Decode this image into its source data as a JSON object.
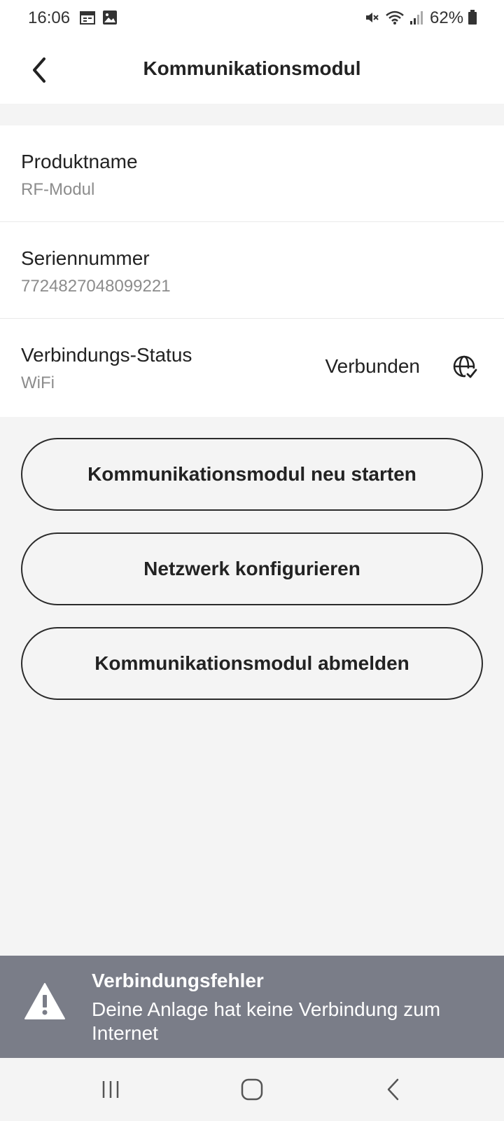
{
  "status_bar": {
    "time": "16:06",
    "battery_percent": "62%",
    "icons": [
      "calendar-icon",
      "image-icon",
      "mute-icon",
      "wifi-icon",
      "signal-icon",
      "battery-icon"
    ]
  },
  "header": {
    "title": "Kommunikationsmodul",
    "back_icon": "chevron-left-icon"
  },
  "info": {
    "product": {
      "label": "Produktname",
      "value": "RF-Modul"
    },
    "serial": {
      "label": "Seriennummer",
      "value": "7724827048099221"
    },
    "connection": {
      "label": "Verbindungs-Status",
      "value": "WiFi",
      "status": "Verbunden",
      "status_icon": "globe-check-icon"
    }
  },
  "actions": {
    "restart": "Kommunikationsmodul neu starten",
    "configure": "Netzwerk konfigurieren",
    "logout": "Kommunikationsmodul abmelden"
  },
  "error_banner": {
    "title": "Verbindungsfehler",
    "message": "Deine Anlage hat keine Verbindung zum Internet",
    "icon": "warning-icon",
    "background_color": "#7a7d88"
  },
  "nav_bar": {
    "icons": [
      "recent-apps-icon",
      "home-icon",
      "back-icon"
    ]
  }
}
